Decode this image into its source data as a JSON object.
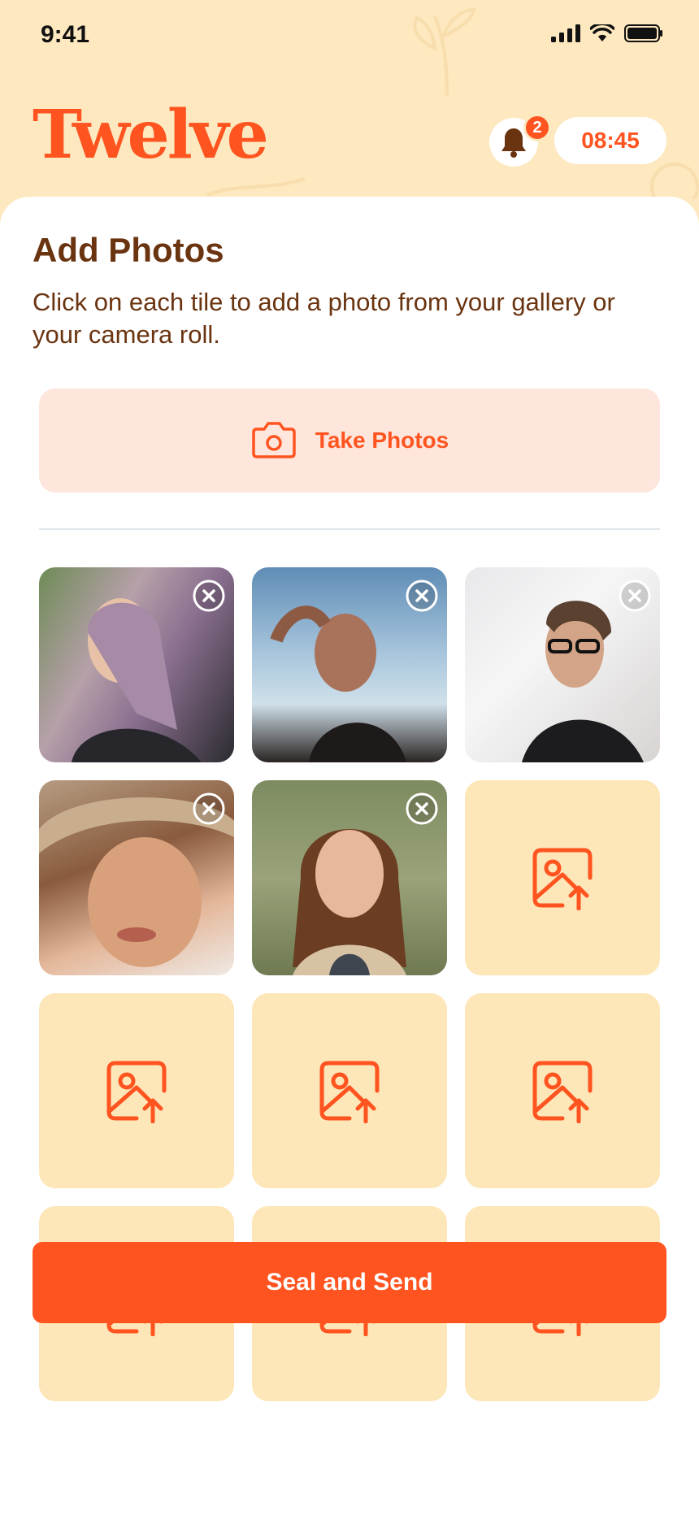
{
  "status_bar": {
    "time": "9:41"
  },
  "header": {
    "brand": "Twelve",
    "notification_count": "2",
    "timer": "08:45"
  },
  "main": {
    "title": "Add Photos",
    "subtitle": "Click on each tile to add a photo from your gallery or your camera roll.",
    "take_photos_label": "Take Photos",
    "submit_label": "Seal and Send"
  },
  "colors": {
    "brand": "#ff541f",
    "cream": "#fde8bf",
    "heading": "#6a3410",
    "take_photos_bg": "#ffe6dc",
    "empty_tile_bg": "#fde6b8"
  },
  "photo_grid": {
    "total_slots": 12,
    "filled_count": 5,
    "tiles": [
      {
        "state": "filled",
        "icon": "close-circle-icon"
      },
      {
        "state": "filled",
        "icon": "close-circle-icon"
      },
      {
        "state": "filled",
        "icon": "close-circle-icon"
      },
      {
        "state": "filled",
        "icon": "close-circle-icon"
      },
      {
        "state": "filled",
        "icon": "close-circle-icon"
      },
      {
        "state": "empty",
        "icon": "image-upload-icon"
      },
      {
        "state": "empty",
        "icon": "image-upload-icon"
      },
      {
        "state": "empty",
        "icon": "image-upload-icon"
      },
      {
        "state": "empty",
        "icon": "image-upload-icon"
      },
      {
        "state": "empty",
        "icon": "image-upload-icon"
      },
      {
        "state": "empty",
        "icon": "image-upload-icon"
      },
      {
        "state": "empty",
        "icon": "image-upload-icon"
      }
    ]
  },
  "icons": {
    "signal": "signal-icon",
    "wifi": "wifi-icon",
    "battery": "battery-icon",
    "bell": "bell-icon",
    "camera": "camera-icon"
  }
}
